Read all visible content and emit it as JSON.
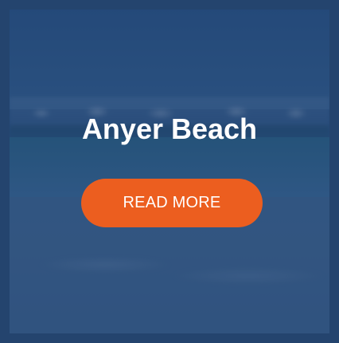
{
  "card": {
    "title": "Anyer Beach",
    "read_more_label": "READ MORE"
  },
  "colors": {
    "overlay": "#1e4070",
    "button": "#ec5e1f",
    "title_text": "#ffffff"
  }
}
